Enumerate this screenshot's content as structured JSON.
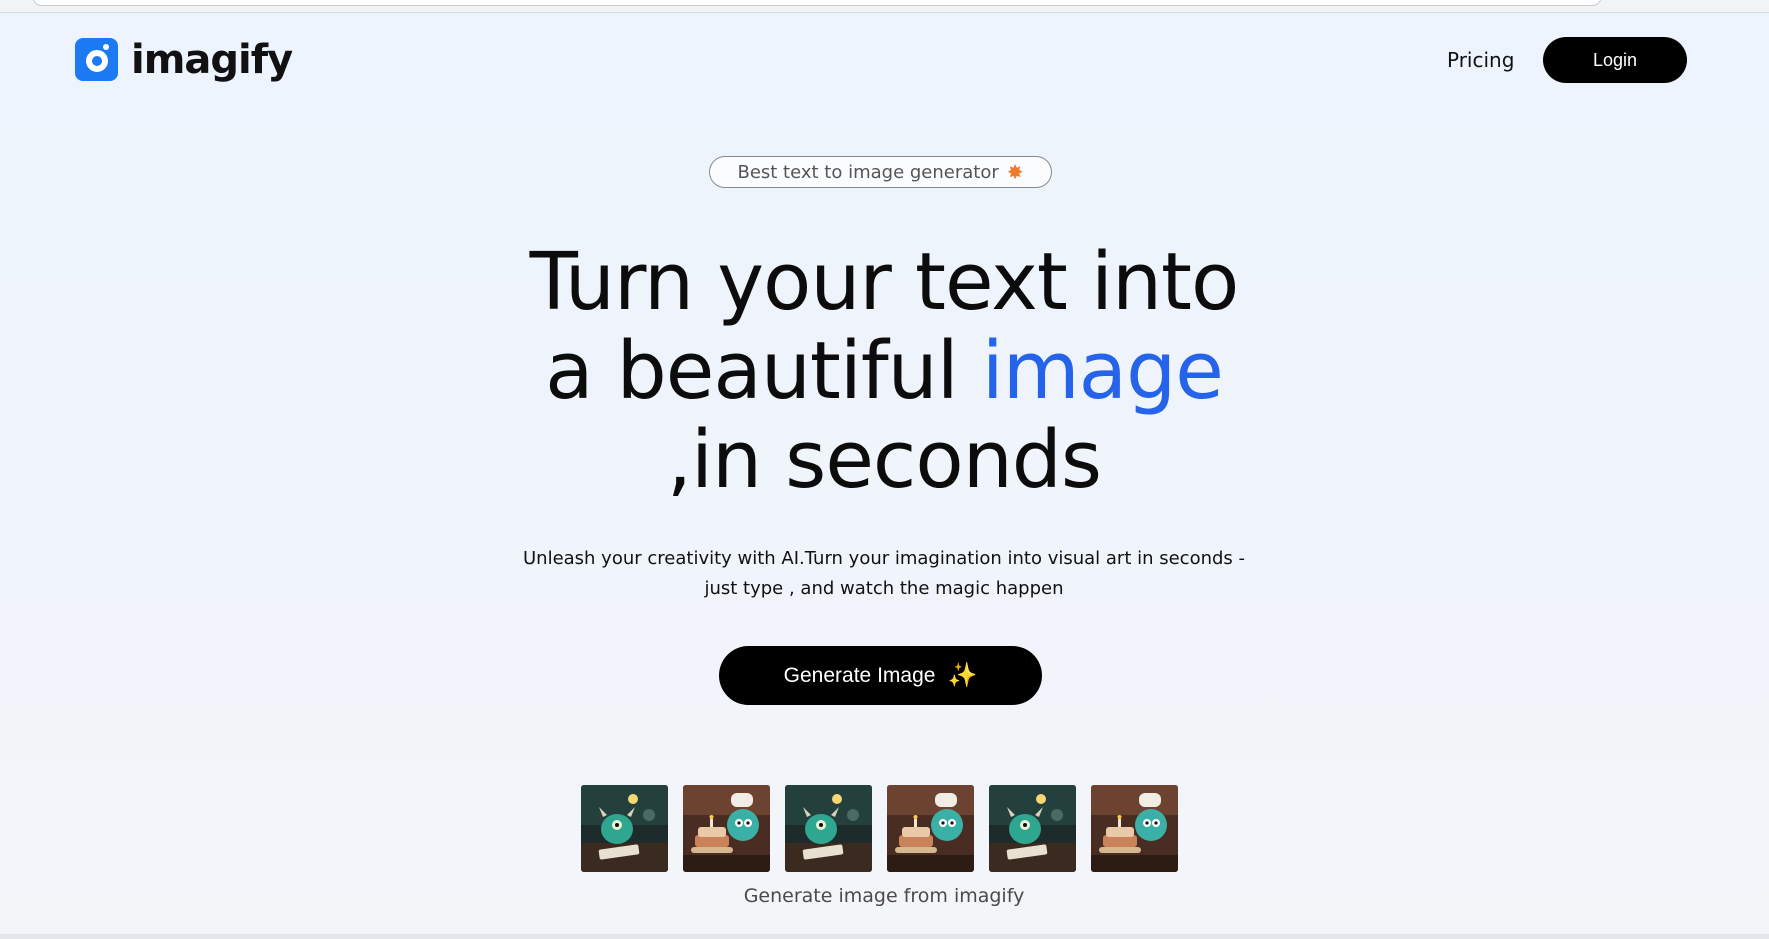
{
  "brand": {
    "name": "imagify"
  },
  "nav": {
    "pricing": "Pricing",
    "login": "Login"
  },
  "hero": {
    "badge": "Best text to image generator",
    "badge_icon": "star-icon",
    "title_line1": "Turn your text into",
    "title_line2_prefix": "a beautiful ",
    "title_line2_accent": "image",
    "title_line3": ",in seconds",
    "subtitle_line1": "Unleash your creativity with AI.Turn your imagination into visual art in seconds -",
    "subtitle_line2": "just type , and watch the magic happen",
    "cta_label": "Generate Image",
    "cta_icon": "sparkles-icon"
  },
  "gallery": {
    "images": [
      "monster-image-1",
      "monster-cake-image-2",
      "monster-image-3",
      "monster-cake-image-4",
      "monster-image-5",
      "monster-cake-image-6"
    ],
    "caption": "Generate image from imagify"
  },
  "colors": {
    "accent": "#2563eb",
    "brand": "#1c7bf2",
    "button": "#000000",
    "background": "#edf4fd"
  }
}
